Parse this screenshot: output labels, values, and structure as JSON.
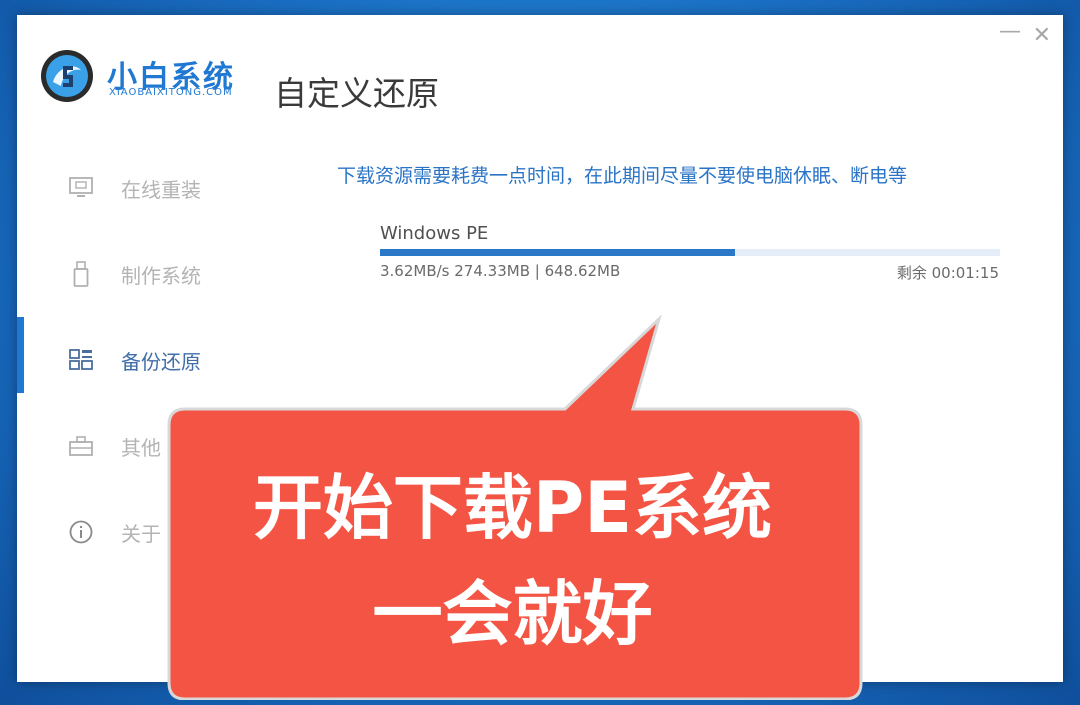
{
  "window": {
    "minimize_glyph": "—",
    "close_glyph": "✕"
  },
  "brand": {
    "name_cn": "小白系统",
    "name_en": "XIAOBAIXITONG.COM",
    "accent": "#1f78d1"
  },
  "page_title": "自定义还原",
  "sidebar": {
    "items": [
      {
        "label": "在线重装",
        "icon": "monitor-icon",
        "active": false
      },
      {
        "label": "制作系统",
        "icon": "usb-drive-icon",
        "active": false
      },
      {
        "label": "备份还原",
        "icon": "grid-icon",
        "active": true
      },
      {
        "label": "其他",
        "icon": "toolbox-icon",
        "active": false
      },
      {
        "label": "关于",
        "icon": "info-icon",
        "active": false
      }
    ]
  },
  "download": {
    "notice": "下载资源需要耗费一点时间，在此期间尽量不要使电脑休眠、断电等",
    "name": "Windows PE",
    "stats": "3.62MB/s 274.33MB | 648.62MB",
    "remaining": "剩余 00:01:15",
    "progress_fraction": 0.572
  },
  "callout": {
    "line1": "开始下载PE系统",
    "line2": "一会就好",
    "color": "#f35443"
  }
}
